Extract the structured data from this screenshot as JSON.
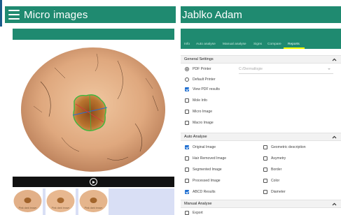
{
  "app": {
    "title": "Micro images"
  },
  "patient": {
    "name": "Jablko Adam"
  },
  "tabs": [
    {
      "label": "Info"
    },
    {
      "label": "Auto analyse"
    },
    {
      "label": "Manual analyse"
    },
    {
      "label": "Signs"
    },
    {
      "label": "Compare"
    },
    {
      "label": "Reports"
    }
  ],
  "active_tab": "Reports",
  "general_settings": {
    "title": "General Settings",
    "pdf_printer": {
      "label": "PDF Printer",
      "selected": true
    },
    "path": {
      "value": "C:/Dermatlogie"
    },
    "default_printer": {
      "label": "Default Printer",
      "selected": false
    },
    "view_pdf": {
      "label": "View PDF results",
      "checked": true
    },
    "mole_info": {
      "label": "Mole Info",
      "checked": false
    },
    "micro_image": {
      "label": "Micro Image",
      "checked": false
    },
    "macro_image": {
      "label": "Macro Image",
      "checked": false
    }
  },
  "auto_analyse": {
    "title": "Auto Analyse",
    "left": [
      {
        "label": "Original Image",
        "checked": true
      },
      {
        "label": "Hair Removed Image",
        "checked": false
      },
      {
        "label": "Segmented Image",
        "checked": false
      },
      {
        "label": "Processed Image",
        "checked": false
      },
      {
        "label": "ABCD Results",
        "checked": true
      }
    ],
    "right": [
      {
        "label": "Geometric description",
        "checked": false
      },
      {
        "label": "Asymetry",
        "checked": false
      },
      {
        "label": "Border",
        "checked": false
      },
      {
        "label": "Color",
        "checked": false
      },
      {
        "label": "Diameter",
        "checked": false
      }
    ]
  },
  "manual_analyse": {
    "title": "Manual Analyse",
    "export": {
      "label": "Export",
      "checked": false
    }
  },
  "thumbnails": [
    {
      "label": "Pink dark brown"
    },
    {
      "label": "Pink dark brown"
    },
    {
      "label": "Pink dark brown"
    }
  ],
  "colors": {
    "primary": "#1f8a70",
    "tab_indicator": "#ffff00",
    "checkbox": "#1f6fd1"
  },
  "icons": {
    "menu": "hamburger-icon",
    "collapse": "chevron-up-icon",
    "play": "play-icon"
  }
}
